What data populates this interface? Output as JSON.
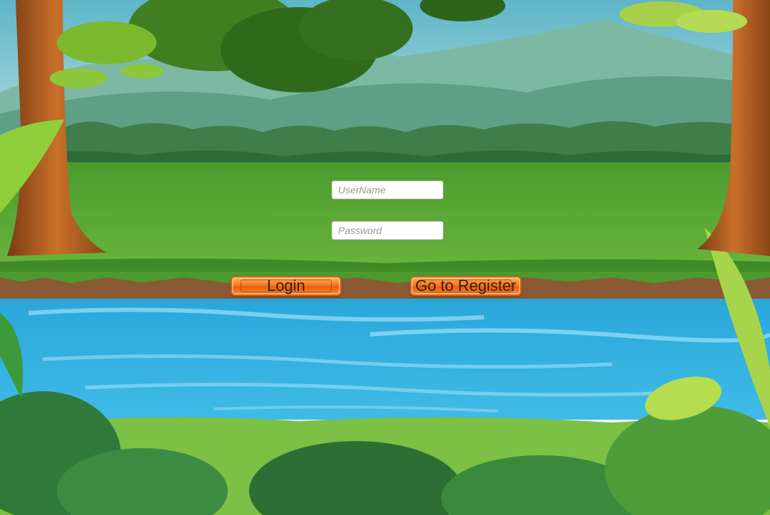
{
  "login_form": {
    "username_placeholder": "UserName",
    "password_placeholder": "Password",
    "login_label": "Login",
    "register_label": "Go to Register"
  },
  "colors": {
    "sky": "#9fd2dc",
    "grass": "#5ba436",
    "river": "#36b3e0",
    "button_orange": "#f57a22",
    "button_text": "#3a1c0e"
  }
}
